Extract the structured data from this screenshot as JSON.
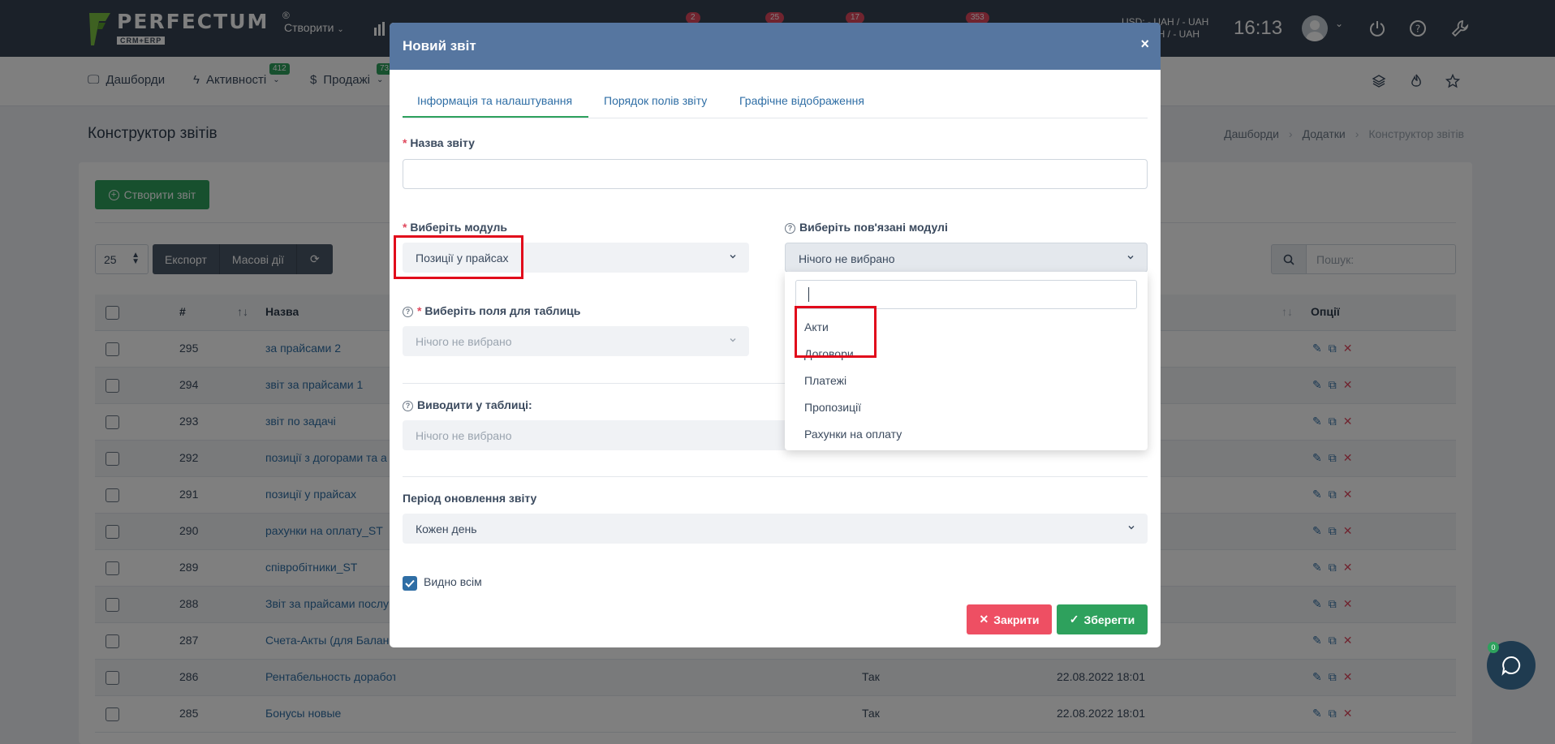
{
  "topbar": {
    "logo_text": "PERFECTUM",
    "logo_reg": "®",
    "logo_sub": "CRM+ERP",
    "create_label": "Створити",
    "badges": [
      "2",
      "25",
      "17",
      "353"
    ],
    "currency_line1": "USD: - UAH / - UAH",
    "currency_line2": "UAH / - UAH",
    "clock": "16:13"
  },
  "nav": {
    "dashboards": "Дашборди",
    "activities": "Активності",
    "activities_badge": "412",
    "sales": "Продажі",
    "sales_badge": "73"
  },
  "page": {
    "title": "Конструктор звітів",
    "breadcrumb": [
      "Дашборди",
      "Додатки",
      "Конструктор звітів"
    ],
    "create_button": "Створити звіт",
    "per_page": "25",
    "export_button": "Експорт",
    "bulk_button": "Масові дії",
    "search_placeholder": "Пошук:"
  },
  "table": {
    "col_num": "#",
    "col_name": "Назва",
    "col_options": "Опції",
    "rows": [
      {
        "id": "295",
        "name": "за прайсами 2",
        "public": "",
        "date": ""
      },
      {
        "id": "294",
        "name": "звіт за прайсами 1",
        "public": "",
        "date": ""
      },
      {
        "id": "293",
        "name": "звіт по задачі",
        "public": "",
        "date": ""
      },
      {
        "id": "292",
        "name": "позиції з догорами та а",
        "public": "",
        "date": ""
      },
      {
        "id": "291",
        "name": "позиції у прайсах",
        "public": "",
        "date": ""
      },
      {
        "id": "290",
        "name": "рахунки на оплату_ST",
        "public": "",
        "date": ""
      },
      {
        "id": "289",
        "name": "співробітники_ST",
        "public": "",
        "date": ""
      },
      {
        "id": "288",
        "name": "Звіт за прайсами послу",
        "public": "",
        "date": ""
      },
      {
        "id": "287",
        "name": "Счета-Акты (для Балан",
        "public": "",
        "date": ""
      },
      {
        "id": "286",
        "name": "Рентабельность доработок",
        "public": "Так",
        "date": "22.08.2022 18:01"
      },
      {
        "id": "285",
        "name": "Бонусы новые",
        "public": "Так",
        "date": "22.08.2022 18:01"
      }
    ]
  },
  "modal": {
    "title": "Новий звіт",
    "close_x": "×",
    "tabs": [
      "Інформація та налаштування",
      "Порядок полів звіту",
      "Графічне відображення"
    ],
    "name_label": "Назва звіту",
    "name_value": "",
    "module_label": "Виберіть модуль",
    "module_value": "Позиції у прайсах",
    "related_label": "Виберіть пов'язані модулі",
    "related_value": "Нічого не вибрано",
    "fields_label": "Виберіть поля для таблиць",
    "fields_value": "Нічого не вибрано",
    "output_label": "Виводити у таблиці:",
    "output_value": "Нічого не вибрано",
    "period_label": "Період оновлення звіту",
    "period_value": "Кожен день",
    "visible_label": "Видно всім",
    "visible_checked": true,
    "close_button": "Закрити",
    "save_button": "Зберегти",
    "dropdown_search": "",
    "dropdown_options": [
      "Акти",
      "Договори",
      "Платежі",
      "Пропозиції",
      "Рахунки на оплату"
    ]
  },
  "chat": {
    "badge": "0"
  },
  "colors": {
    "topbar": "#364352",
    "modal_header": "#5676a0",
    "green": "#2ea15d",
    "red": "#ee4f63",
    "highlight": "#e10a1b"
  }
}
